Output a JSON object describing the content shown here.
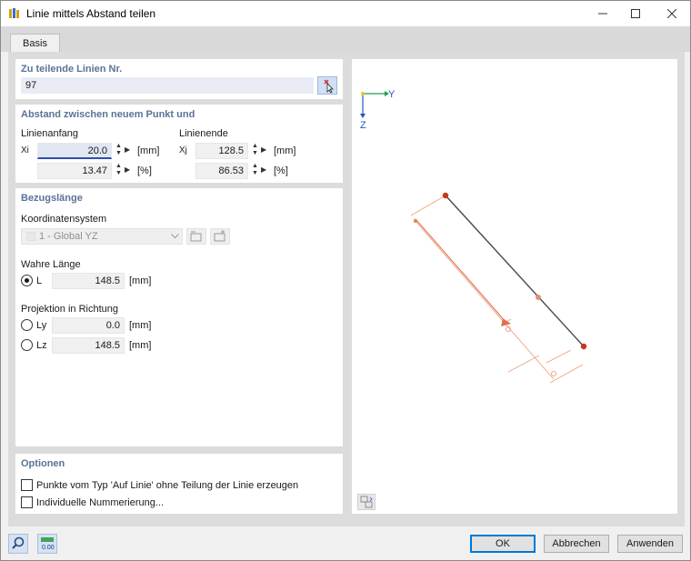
{
  "window": {
    "title": "Linie mittels Abstand teilen"
  },
  "tabs": [
    {
      "label": "Basis"
    }
  ],
  "section_lines": {
    "title": "Zu teilende Linien Nr.",
    "value": "97"
  },
  "section_distance": {
    "title": "Abstand zwischen neuem Punkt und",
    "start": {
      "label": "Linienanfang",
      "symbol": "Xi",
      "value": "20.0",
      "unit": "[mm]",
      "percent": "13.47",
      "percent_unit": "[%]"
    },
    "end": {
      "label": "Linienende",
      "symbol": "Xj",
      "value": "128.5",
      "unit": "[mm]",
      "percent": "86.53",
      "percent_unit": "[%]"
    }
  },
  "section_reference": {
    "title": "Bezugslänge",
    "coord_label": "Koordinatensystem",
    "coord_value": "1 - Global YZ",
    "true_length_label": "Wahre Länge",
    "true_length": {
      "symbol": "L",
      "value": "148.5",
      "unit": "[mm]",
      "selected": true
    },
    "projection_label": "Projektion in Richtung",
    "proj_y": {
      "symbol": "Ly",
      "value": "0.0",
      "unit": "[mm]",
      "selected": false
    },
    "proj_z": {
      "symbol": "Lz",
      "value": "148.5",
      "unit": "[mm]",
      "selected": false
    }
  },
  "section_options": {
    "title": "Optionen",
    "opt1": "Punkte vom Typ 'Auf Linie' ohne Teilung der Linie erzeugen",
    "opt2": "Individuelle Nummerierung..."
  },
  "preview": {
    "axis_y": "Y",
    "axis_z": "Z"
  },
  "buttons": {
    "ok": "OK",
    "cancel": "Abbrechen",
    "apply": "Anwenden"
  },
  "colors": {
    "accent": "#5a7397",
    "line": "#505050",
    "node": "#c8361c",
    "dimension": "#f0a080"
  }
}
